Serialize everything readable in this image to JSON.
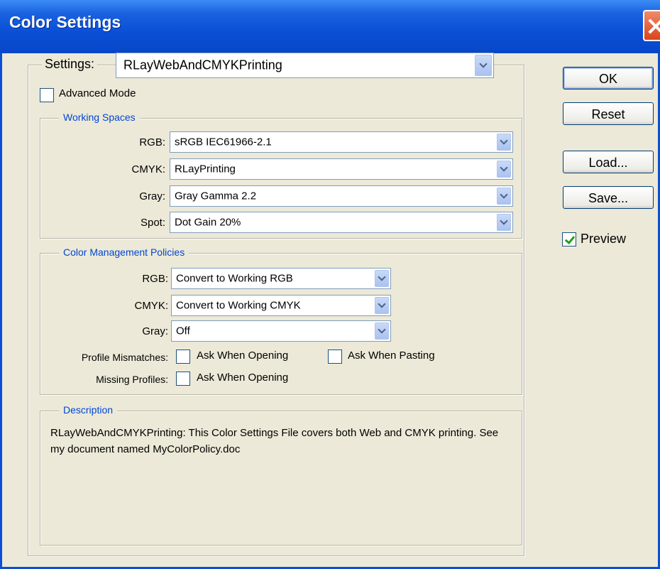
{
  "window": {
    "title": "Color Settings"
  },
  "settings": {
    "label": "Settings:",
    "value": "RLayWebAndCMYKPrinting"
  },
  "advanced_mode": {
    "label": "Advanced Mode",
    "checked": false
  },
  "working_spaces": {
    "title": "Working Spaces",
    "rgb": {
      "label": "RGB:",
      "value": "sRGB IEC61966-2.1"
    },
    "cmyk": {
      "label": "CMYK:",
      "value": "RLayPrinting"
    },
    "gray": {
      "label": "Gray:",
      "value": "Gray Gamma 2.2"
    },
    "spot": {
      "label": "Spot:",
      "value": "Dot Gain 20%"
    }
  },
  "policies": {
    "title": "Color Management Policies",
    "rgb": {
      "label": "RGB:",
      "value": "Convert to Working RGB"
    },
    "cmyk": {
      "label": "CMYK:",
      "value": "Convert to Working CMYK"
    },
    "gray": {
      "label": "Gray:",
      "value": "Off"
    },
    "profile_mismatches": {
      "label": "Profile Mismatches:",
      "ask_opening": "Ask When Opening",
      "ask_pasting": "Ask When Pasting"
    },
    "missing_profiles": {
      "label": "Missing Profiles:",
      "ask_opening": "Ask When Opening"
    }
  },
  "description": {
    "title": "Description",
    "text": "RLayWebAndCMYKPrinting:  This Color Settings File covers both Web and CMYK printing. See my document named MyColorPolicy.doc"
  },
  "buttons": {
    "ok": "OK",
    "reset": "Reset",
    "load": "Load...",
    "save": "Save..."
  },
  "preview": {
    "label": "Preview",
    "checked": true
  },
  "colors": {
    "title_bar": "#0a4fd6",
    "dialog_bg": "#ece9d8",
    "group_title": "#0046d5",
    "check_mark": "#21a121"
  }
}
